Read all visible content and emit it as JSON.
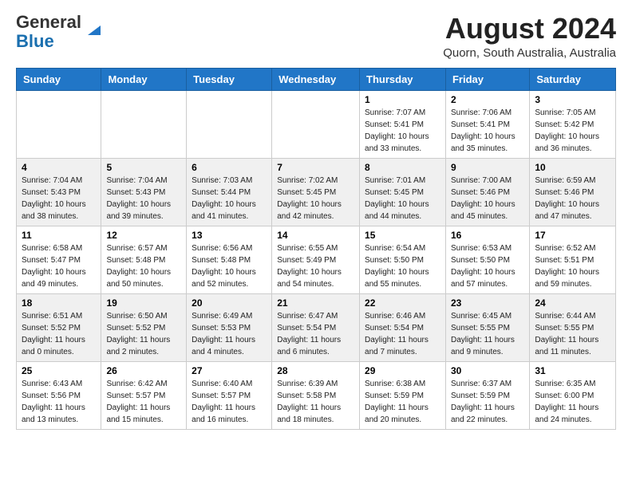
{
  "header": {
    "logo_line1": "General",
    "logo_line2": "Blue",
    "month_title": "August 2024",
    "subtitle": "Quorn, South Australia, Australia"
  },
  "weekdays": [
    "Sunday",
    "Monday",
    "Tuesday",
    "Wednesday",
    "Thursday",
    "Friday",
    "Saturday"
  ],
  "weeks": [
    [
      {
        "day": "",
        "sunrise": "",
        "sunset": "",
        "daylight": ""
      },
      {
        "day": "",
        "sunrise": "",
        "sunset": "",
        "daylight": ""
      },
      {
        "day": "",
        "sunrise": "",
        "sunset": "",
        "daylight": ""
      },
      {
        "day": "",
        "sunrise": "",
        "sunset": "",
        "daylight": ""
      },
      {
        "day": "1",
        "sunrise": "Sunrise: 7:07 AM",
        "sunset": "Sunset: 5:41 PM",
        "daylight": "Daylight: 10 hours and 33 minutes."
      },
      {
        "day": "2",
        "sunrise": "Sunrise: 7:06 AM",
        "sunset": "Sunset: 5:41 PM",
        "daylight": "Daylight: 10 hours and 35 minutes."
      },
      {
        "day": "3",
        "sunrise": "Sunrise: 7:05 AM",
        "sunset": "Sunset: 5:42 PM",
        "daylight": "Daylight: 10 hours and 36 minutes."
      }
    ],
    [
      {
        "day": "4",
        "sunrise": "Sunrise: 7:04 AM",
        "sunset": "Sunset: 5:43 PM",
        "daylight": "Daylight: 10 hours and 38 minutes."
      },
      {
        "day": "5",
        "sunrise": "Sunrise: 7:04 AM",
        "sunset": "Sunset: 5:43 PM",
        "daylight": "Daylight: 10 hours and 39 minutes."
      },
      {
        "day": "6",
        "sunrise": "Sunrise: 7:03 AM",
        "sunset": "Sunset: 5:44 PM",
        "daylight": "Daylight: 10 hours and 41 minutes."
      },
      {
        "day": "7",
        "sunrise": "Sunrise: 7:02 AM",
        "sunset": "Sunset: 5:45 PM",
        "daylight": "Daylight: 10 hours and 42 minutes."
      },
      {
        "day": "8",
        "sunrise": "Sunrise: 7:01 AM",
        "sunset": "Sunset: 5:45 PM",
        "daylight": "Daylight: 10 hours and 44 minutes."
      },
      {
        "day": "9",
        "sunrise": "Sunrise: 7:00 AM",
        "sunset": "Sunset: 5:46 PM",
        "daylight": "Daylight: 10 hours and 45 minutes."
      },
      {
        "day": "10",
        "sunrise": "Sunrise: 6:59 AM",
        "sunset": "Sunset: 5:46 PM",
        "daylight": "Daylight: 10 hours and 47 minutes."
      }
    ],
    [
      {
        "day": "11",
        "sunrise": "Sunrise: 6:58 AM",
        "sunset": "Sunset: 5:47 PM",
        "daylight": "Daylight: 10 hours and 49 minutes."
      },
      {
        "day": "12",
        "sunrise": "Sunrise: 6:57 AM",
        "sunset": "Sunset: 5:48 PM",
        "daylight": "Daylight: 10 hours and 50 minutes."
      },
      {
        "day": "13",
        "sunrise": "Sunrise: 6:56 AM",
        "sunset": "Sunset: 5:48 PM",
        "daylight": "Daylight: 10 hours and 52 minutes."
      },
      {
        "day": "14",
        "sunrise": "Sunrise: 6:55 AM",
        "sunset": "Sunset: 5:49 PM",
        "daylight": "Daylight: 10 hours and 54 minutes."
      },
      {
        "day": "15",
        "sunrise": "Sunrise: 6:54 AM",
        "sunset": "Sunset: 5:50 PM",
        "daylight": "Daylight: 10 hours and 55 minutes."
      },
      {
        "day": "16",
        "sunrise": "Sunrise: 6:53 AM",
        "sunset": "Sunset: 5:50 PM",
        "daylight": "Daylight: 10 hours and 57 minutes."
      },
      {
        "day": "17",
        "sunrise": "Sunrise: 6:52 AM",
        "sunset": "Sunset: 5:51 PM",
        "daylight": "Daylight: 10 hours and 59 minutes."
      }
    ],
    [
      {
        "day": "18",
        "sunrise": "Sunrise: 6:51 AM",
        "sunset": "Sunset: 5:52 PM",
        "daylight": "Daylight: 11 hours and 0 minutes."
      },
      {
        "day": "19",
        "sunrise": "Sunrise: 6:50 AM",
        "sunset": "Sunset: 5:52 PM",
        "daylight": "Daylight: 11 hours and 2 minutes."
      },
      {
        "day": "20",
        "sunrise": "Sunrise: 6:49 AM",
        "sunset": "Sunset: 5:53 PM",
        "daylight": "Daylight: 11 hours and 4 minutes."
      },
      {
        "day": "21",
        "sunrise": "Sunrise: 6:47 AM",
        "sunset": "Sunset: 5:54 PM",
        "daylight": "Daylight: 11 hours and 6 minutes."
      },
      {
        "day": "22",
        "sunrise": "Sunrise: 6:46 AM",
        "sunset": "Sunset: 5:54 PM",
        "daylight": "Daylight: 11 hours and 7 minutes."
      },
      {
        "day": "23",
        "sunrise": "Sunrise: 6:45 AM",
        "sunset": "Sunset: 5:55 PM",
        "daylight": "Daylight: 11 hours and 9 minutes."
      },
      {
        "day": "24",
        "sunrise": "Sunrise: 6:44 AM",
        "sunset": "Sunset: 5:55 PM",
        "daylight": "Daylight: 11 hours and 11 minutes."
      }
    ],
    [
      {
        "day": "25",
        "sunrise": "Sunrise: 6:43 AM",
        "sunset": "Sunset: 5:56 PM",
        "daylight": "Daylight: 11 hours and 13 minutes."
      },
      {
        "day": "26",
        "sunrise": "Sunrise: 6:42 AM",
        "sunset": "Sunset: 5:57 PM",
        "daylight": "Daylight: 11 hours and 15 minutes."
      },
      {
        "day": "27",
        "sunrise": "Sunrise: 6:40 AM",
        "sunset": "Sunset: 5:57 PM",
        "daylight": "Daylight: 11 hours and 16 minutes."
      },
      {
        "day": "28",
        "sunrise": "Sunrise: 6:39 AM",
        "sunset": "Sunset: 5:58 PM",
        "daylight": "Daylight: 11 hours and 18 minutes."
      },
      {
        "day": "29",
        "sunrise": "Sunrise: 6:38 AM",
        "sunset": "Sunset: 5:59 PM",
        "daylight": "Daylight: 11 hours and 20 minutes."
      },
      {
        "day": "30",
        "sunrise": "Sunrise: 6:37 AM",
        "sunset": "Sunset: 5:59 PM",
        "daylight": "Daylight: 11 hours and 22 minutes."
      },
      {
        "day": "31",
        "sunrise": "Sunrise: 6:35 AM",
        "sunset": "Sunset: 6:00 PM",
        "daylight": "Daylight: 11 hours and 24 minutes."
      }
    ]
  ]
}
